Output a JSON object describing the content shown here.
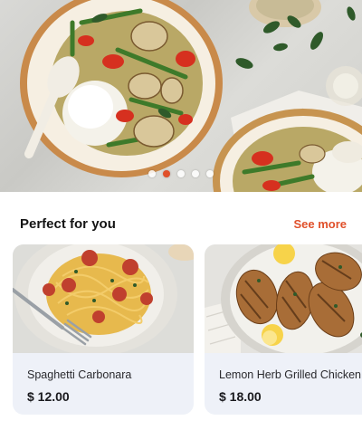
{
  "hero": {
    "slides": 5,
    "active_slide": 2
  },
  "section": {
    "title": "Perfect for you",
    "see_more": "See more"
  },
  "dishes": [
    {
      "name": "Spaghetti Carbonara",
      "price": "$ 12.00"
    },
    {
      "name": "Lemon Herb Grilled Chicken",
      "price": "$ 18.00"
    }
  ],
  "colors": {
    "accent": "#e0502a",
    "card_bg": "#eef1f8"
  }
}
